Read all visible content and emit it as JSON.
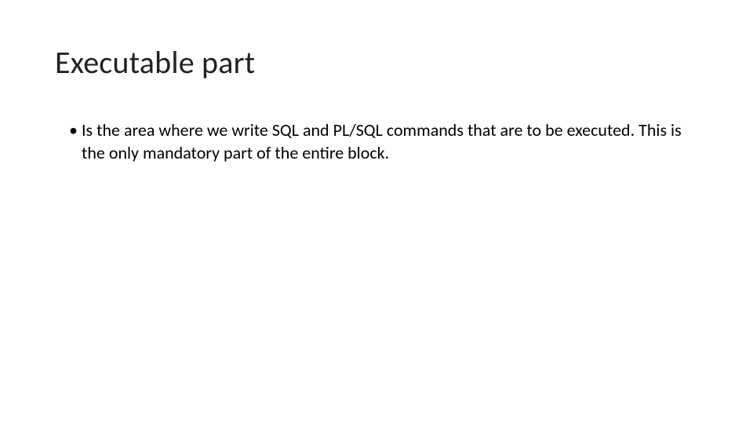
{
  "slide": {
    "title": "Executable part",
    "bullets": [
      {
        "text": "Is the area where we write SQL and PL/SQL commands that are to be executed. This is the only mandatory part of the entire block."
      }
    ]
  }
}
